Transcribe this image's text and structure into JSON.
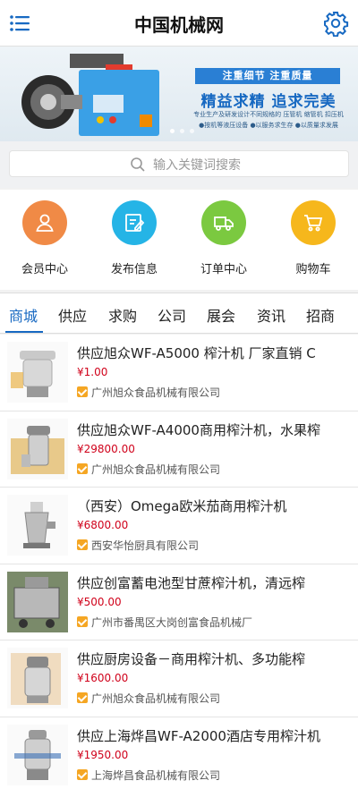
{
  "header": {
    "title": "中国机械网",
    "menu_icon": "menu-icon",
    "settings_icon": "gear-icon"
  },
  "banner": {
    "tag": "注重细节 注重质量",
    "headline": "精益求精 追求完美",
    "sub1": "专业生产及研发设计不同规格的 压管机 缩管机 扣压机",
    "sub2": "●按机等液压设备 ●以服务求生存 ●以质量求发展",
    "dot_count": 3,
    "active_dot": 0
  },
  "search": {
    "placeholder": "输入关键词搜索"
  },
  "shortcuts": [
    {
      "label": "会员中心",
      "icon": "user-icon",
      "color": "#f08a46"
    },
    {
      "label": "发布信息",
      "icon": "edit-icon",
      "color": "#25b4e6"
    },
    {
      "label": "订单中心",
      "icon": "truck-icon",
      "color": "#7bc940"
    },
    {
      "label": "购物车",
      "icon": "cart-icon",
      "color": "#f6b71c"
    }
  ],
  "tabs": [
    "商城",
    "供应",
    "求购",
    "公司",
    "展会",
    "资讯",
    "招商"
  ],
  "active_tab": 0,
  "products": [
    {
      "name": "供应旭众WF-A5000 榨汁机 厂家直销 C",
      "price": "¥1.00",
      "company": "广州旭众食品机械有限公司"
    },
    {
      "name": "供应旭众WF-A4000商用榨汁机，水果榨",
      "price": "¥29800.00",
      "company": "广州旭众食品机械有限公司"
    },
    {
      "name": "（西安）Omega欧米茄商用榨汁机",
      "price": "¥6800.00",
      "company": "西安华怡厨具有限公司"
    },
    {
      "name": "供应创富蓄电池型甘蔗榨汁机，清远榨",
      "price": "¥500.00",
      "company": "广州市番禺区大岗创富食品机械厂"
    },
    {
      "name": "供应厨房设备－商用榨汁机、多功能榨",
      "price": "¥1600.00",
      "company": "广州旭众食品机械有限公司"
    },
    {
      "name": "供应上海烨昌WF-A2000酒店专用榨汁机",
      "price": "¥1950.00",
      "company": "上海烨昌食品机械有限公司"
    }
  ],
  "colors": {
    "accent": "#1769c2",
    "price": "#d0021b",
    "verified": "#f5a623"
  }
}
